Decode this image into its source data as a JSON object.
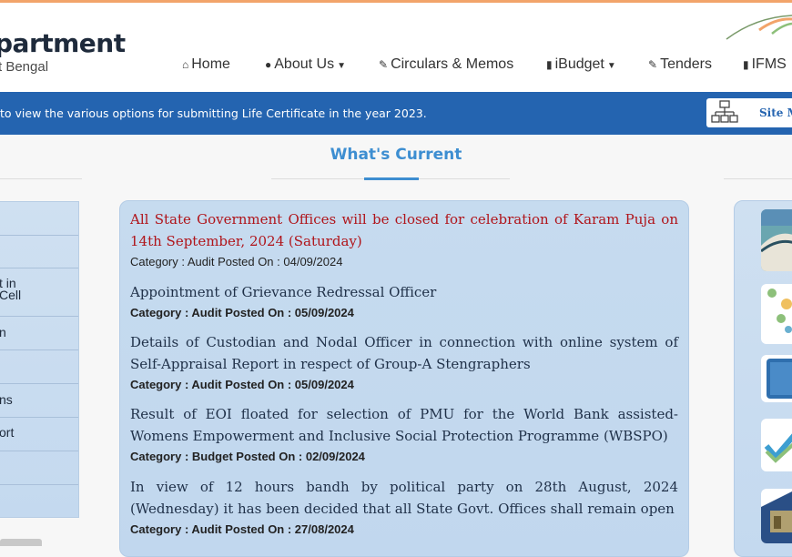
{
  "header": {
    "brand_title": "partment",
    "brand_subtitle": "t Bengal"
  },
  "nav": {
    "items": [
      {
        "label": "Home",
        "icon": "home-icon",
        "dropdown": false
      },
      {
        "label": "About Us",
        "icon": "user-icon",
        "dropdown": true
      },
      {
        "label": "Circulars & Memos",
        "icon": "edit-icon",
        "dropdown": false
      },
      {
        "label": "iBudget",
        "icon": "book-icon",
        "dropdown": true
      },
      {
        "label": "Tenders",
        "icon": "edit-icon",
        "dropdown": false
      },
      {
        "label": "IFMS",
        "icon": "book-icon",
        "dropdown": false
      }
    ]
  },
  "banner": {
    "message": "to view the various options for submitting Life Certificate in the year 2023.",
    "sitemap_label": "Site M"
  },
  "section_title": "What's Current",
  "left_menu": {
    "items": [
      {
        "label": ""
      },
      {
        "label": ""
      },
      {
        "label": "t in\nCell"
      },
      {
        "label": "n"
      },
      {
        "label": ""
      },
      {
        "label": "ns"
      },
      {
        "label": "ort"
      },
      {
        "label": ""
      },
      {
        "label": ""
      }
    ]
  },
  "news": [
    {
      "title": "All State Government Offices will be closed for celebration of Karam Puja on 14th September, 2024 (Saturday)",
      "meta": "Category : Audit Posted On :  04/09/2024",
      "highlight": true
    },
    {
      "title": "Appointment of Grievance Redressal Officer",
      "meta": "Category : Audit Posted On : 05/09/2024",
      "highlight": false
    },
    {
      "title": "Details of Custodian and Nodal Officer in connection with online system of Self-Appraisal Report in respect of Group-A Stengraphers",
      "meta": "Category : Audit Posted On : 05/09/2024",
      "highlight": false
    },
    {
      "title": "Result of EOI floated for selection of PMU for the World Bank assisted- Womens Empowerment and Inclusive Social Protection Programme (WBSPO)",
      "meta": "Category : Budget Posted On : 02/09/2024",
      "highlight": false
    },
    {
      "title": "In view of 12 hours bandh by political party on 28th August, 2024 (Wednesday) it has been decided that all State Govt. Offices shall remain open",
      "meta": "Category : Audit Posted On : 27/08/2024",
      "highlight": false
    }
  ],
  "colors": {
    "banner_blue": "#2464b0",
    "accent_blue": "#3d8ed1",
    "highlight_red": "#b0141a",
    "top_line": "#f2a46a"
  }
}
